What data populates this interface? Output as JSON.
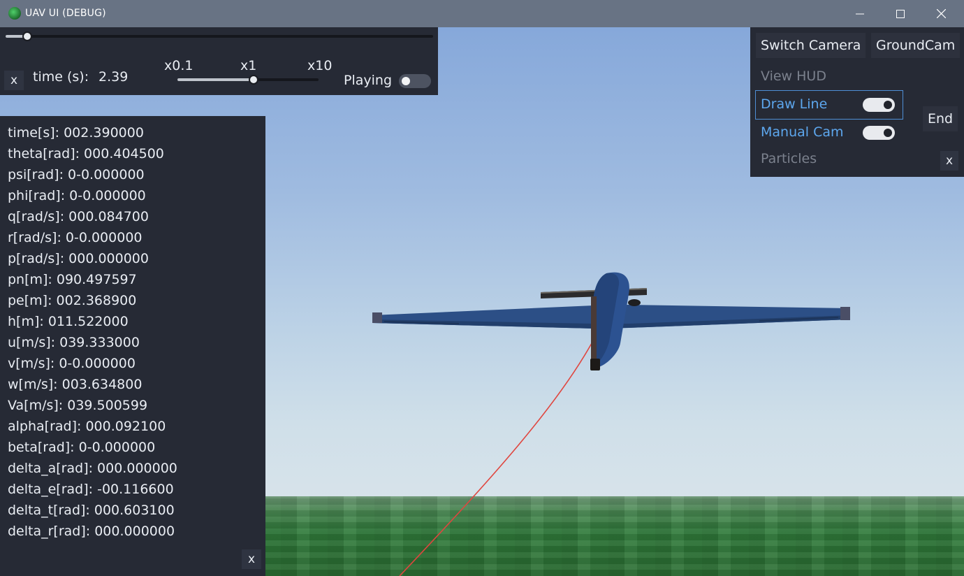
{
  "window": {
    "title": "UAV UI (DEBUG)",
    "app_icon": "app-globe-icon",
    "controls": {
      "minimize": "—",
      "maximize": "☐",
      "close": "✕"
    }
  },
  "timeline": {
    "close_label": "x",
    "time_label": "time (s):",
    "time_value": "2.39",
    "speed_labels": [
      "x0.1",
      "x1",
      "x10"
    ],
    "playing_label": "Playing",
    "playing": false,
    "scrub_fraction": 0.05,
    "speed_fraction": 0.54
  },
  "telemetry": {
    "rows": [
      "time[s]: 002.390000",
      "theta[rad]: 000.404500",
      "psi[rad]: 0-0.000000",
      "phi[rad]: 0-0.000000",
      "q[rad/s]: 000.084700",
      "r[rad/s]: 0-0.000000",
      "p[rad/s]: 000.000000",
      "pn[m]: 090.497597",
      "pe[m]: 002.368900",
      "h[m]: 011.522000",
      "u[m/s]: 039.333000",
      "v[m/s]: 0-0.000000",
      "w[m/s]: 003.634800",
      "Va[m/s]: 039.500599",
      "alpha[rad]: 000.092100",
      "beta[rad]: 0-0.000000",
      "delta_a[rad]: 000.000000",
      "delta_e[rad]: -00.116600",
      "delta_t[rad]: 000.603100",
      "delta_r[rad]: 000.000000"
    ],
    "close_label": "x"
  },
  "camera_panel": {
    "switch_camera_label": "Switch Camera",
    "groundcam_label": "GroundCam",
    "view_hud_label": "View HUD",
    "draw_line_label": "Draw Line",
    "draw_line_on": true,
    "manual_cam_label": "Manual Cam",
    "manual_cam_on": true,
    "particles_label": "Particles",
    "end_label": "End",
    "close_label": "x"
  },
  "colors": {
    "panel_bg": "#262a35",
    "accent_blue": "#5da7ee",
    "trail_red": "#e0463f",
    "aircraft_blue": "#2c4f86"
  }
}
